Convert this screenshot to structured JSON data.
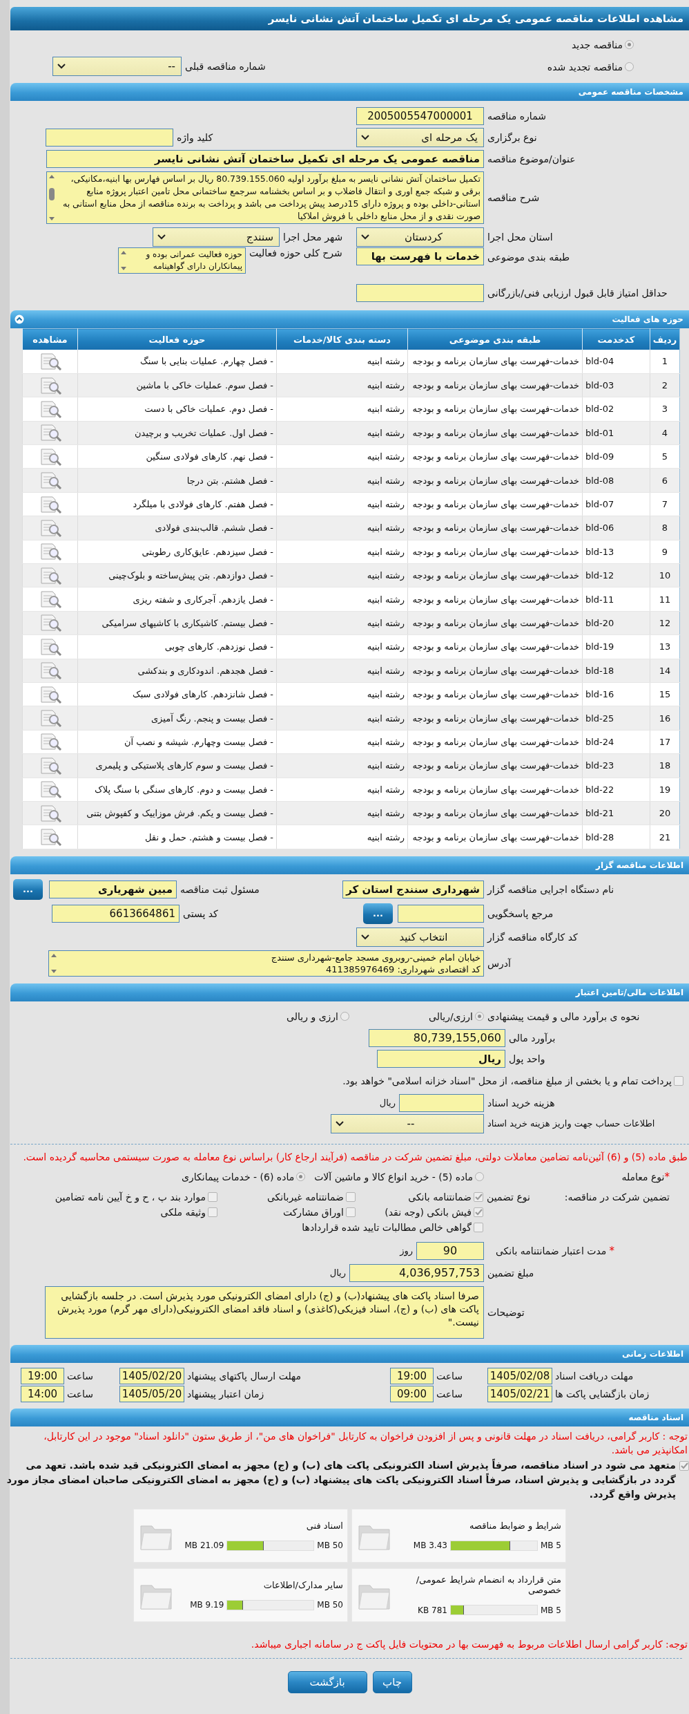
{
  "page_title": "مشاهده اطلاعات مناقصه عمومی یک مرحله ای تکمیل ساختمان آتش نشانی نایسر",
  "tender_status": [
    {
      "label": "مناقصه جدید",
      "selected": true
    },
    {
      "label": "مناقصه تجدید شده",
      "selected": false
    }
  ],
  "previous_tender": {
    "label": "شماره مناقصه قبلی",
    "value": "--"
  },
  "general": {
    "header": "مشخصات مناقصه عمومی",
    "tender_number": {
      "label": "شماره مناقصه",
      "value": "2005005547000001"
    },
    "holding_type": {
      "label": "نوع برگزاری",
      "value": "یک مرحله ای"
    },
    "keyword": {
      "label": "کلید واژه"
    },
    "title": {
      "label": "عنوان/موضوع مناقصه",
      "value": "مناقصه عمومی یک مرحله ای تکمیل ساختمان آتش نشانی نایسر"
    },
    "description": {
      "label": "شرح مناقصه",
      "value": "تکمیل ساختمان آتش نشانی نایسر به مبلغ برآورد اولیه 80.739.155.060 ریال بر اساس فهارس بها ابنیه،مکانیکی، برقی و شبکه جمع اوری و انتقال فاضلاب و بر اساس بخشنامه سرجمع  ساختمانی محل تامین اعتبار پروژه منابع استانی-داخلی بوده و پروژه دارای 15درصد پیش پرداخت می باشد و پرداخت به برنده مناقصه از محل منابع استانی به صورت نقدی و از محل منابع داخلی با فروش املاکیا"
    },
    "province": {
      "label": "استان محل اجرا",
      "value": "کردستان"
    },
    "city": {
      "label": "شهر محل اجرا",
      "value": "سنندج"
    },
    "category": {
      "label": "طبقه بندی موضوعی",
      "value": "خدمات با فهرست بها"
    },
    "activity_summary": {
      "label": "شرح کلی حوزه فعالیت",
      "value": "حوزه فعالیت عمرانی بوده و پیمانکاران دارای گواهینامه"
    },
    "min_score": {
      "label": "حداقل امتیاز قابل قبول ارزیابی فنی/بازرگانی"
    }
  },
  "activities": {
    "header": "حوزه های فعالیت",
    "expanded": true,
    "columns": [
      "ردیف",
      "کدخدمت",
      "طبقه بندی موضوعی",
      "دسته بندی کالا/خدمات",
      "حوزه فعالیت",
      "مشاهده"
    ],
    "rows": [
      {
        "row": "1",
        "code": "bld-04",
        "category": "خدمات-فهرست بهای سازمان برنامه و بودجه",
        "group": "رشته ابنیه",
        "activity": "- فصل چهارم. عملیات بنایی با سنگ"
      },
      {
        "row": "2",
        "code": "bld-03",
        "category": "خدمات-فهرست بهای سازمان برنامه و بودجه",
        "group": "رشته ابنیه",
        "activity": "- فصل سوم. عملیات خاکی با ماشین"
      },
      {
        "row": "3",
        "code": "bld-02",
        "category": "خدمات-فهرست بهای سازمان برنامه و بودجه",
        "group": "رشته ابنیه",
        "activity": "- فصل دوم. عملیات خاکی با دست"
      },
      {
        "row": "4",
        "code": "bld-01",
        "category": "خدمات-فهرست بهای سازمان برنامه و بودجه",
        "group": "رشته ابنیه",
        "activity": "- فصل اول. عملیات تخریب و برچیدن"
      },
      {
        "row": "5",
        "code": "bld-09",
        "category": "خدمات-فهرست بهای سازمان برنامه و بودجه",
        "group": "رشته ابنیه",
        "activity": "- فصل نهم. کارهای فولادی سنگین"
      },
      {
        "row": "6",
        "code": "bld-08",
        "category": "خدمات-فهرست بهای سازمان برنامه و بودجه",
        "group": "رشته ابنیه",
        "activity": "- فصل هشتم. بتن درجا"
      },
      {
        "row": "7",
        "code": "bld-07",
        "category": "خدمات-فهرست بهای سازمان برنامه و بودجه",
        "group": "رشته ابنیه",
        "activity": "- فصل هفتم. کارهای فولادی با میلگرد"
      },
      {
        "row": "8",
        "code": "bld-06",
        "category": "خدمات-فهرست بهای سازمان برنامه و بودجه",
        "group": "رشته ابنیه",
        "activity": "- فصل ششم. قالب‌بندی فولادی"
      },
      {
        "row": "9",
        "code": "bld-13",
        "category": "خدمات-فهرست بهای سازمان برنامه و بودجه",
        "group": "رشته ابنیه",
        "activity": "- فصل سیزدهم. عایق‌کاری رطوبتی"
      },
      {
        "row": "10",
        "code": "bld-12",
        "category": "خدمات-فهرست بهای سازمان برنامه و بودجه",
        "group": "رشته ابنیه",
        "activity": "- فصل دوازدهم. بتن پیش‌ساخته و بلوک‌چینی"
      },
      {
        "row": "11",
        "code": "bld-11",
        "category": "خدمات-فهرست بهای سازمان برنامه و بودجه",
        "group": "رشته ابنیه",
        "activity": "- فصل یازدهم. آجرکاری و شفته ریزی"
      },
      {
        "row": "12",
        "code": "bld-20",
        "category": "خدمات-فهرست بهای سازمان برنامه و بودجه",
        "group": "رشته ابنیه",
        "activity": "- فصل بیستم. کاشیکاری با کاشیهای سرامیکی"
      },
      {
        "row": "13",
        "code": "bld-19",
        "category": "خدمات-فهرست بهای سازمان برنامه و بودجه",
        "group": "رشته ابنیه",
        "activity": "- فصل نوزدهم. کارهای چوبی"
      },
      {
        "row": "14",
        "code": "bld-18",
        "category": "خدمات-فهرست بهای سازمان برنامه و بودجه",
        "group": "رشته ابنیه",
        "activity": "- فصل هجدهم. اندودکاری و بندکشی"
      },
      {
        "row": "15",
        "code": "bld-16",
        "category": "خدمات-فهرست بهای سازمان برنامه و بودجه",
        "group": "رشته ابنیه",
        "activity": "- فصل شانزدهم. کارهای فولادی سبک"
      },
      {
        "row": "16",
        "code": "bld-25",
        "category": "خدمات-فهرست بهای سازمان برنامه و بودجه",
        "group": "رشته ابنیه",
        "activity": "- فصل بیست و پنجم. رنگ آمیزی"
      },
      {
        "row": "17",
        "code": "bld-24",
        "category": "خدمات-فهرست بهای سازمان برنامه و بودجه",
        "group": "رشته ابنیه",
        "activity": "- فصل بیست وچهارم. شیشه و نصب آن"
      },
      {
        "row": "18",
        "code": "bld-23",
        "category": "خدمات-فهرست بهای سازمان برنامه و بودجه",
        "group": "رشته ابنیه",
        "activity": "- فصل بیست و سوم کارهای پلاستیکی و پلیمری"
      },
      {
        "row": "19",
        "code": "bld-22",
        "category": "خدمات-فهرست بهای سازمان برنامه و بودجه",
        "group": "رشته ابنیه",
        "activity": "- فصل بیست و دوم. کارهای سنگی با سنگ پلاک"
      },
      {
        "row": "20",
        "code": "bld-21",
        "category": "خدمات-فهرست بهای سازمان برنامه و بودجه",
        "group": "رشته ابنیه",
        "activity": "- فصل بیست و یکم. فرش موزاییک و کفپوش بتنی"
      },
      {
        "row": "21",
        "code": "bld-28",
        "category": "خدمات-فهرست بهای سازمان برنامه و بودجه",
        "group": "رشته ابنیه",
        "activity": "- فصل بیست و هشتم. حمل و نقل"
      }
    ]
  },
  "organizer": {
    "header": "اطلاعات مناقصه گزار",
    "agency": {
      "label": "نام دستگاه اجرایی مناقصه گزار",
      "value": "شهرداری سنندج استان کر"
    },
    "registrar": {
      "label": "مسئول ثبت مناقصه",
      "value": "مبین شهریاری",
      "button": "..."
    },
    "reference": {
      "label": "مرجع پاسخگویی",
      "button": "..."
    },
    "postal_code": {
      "label": "کد پستی",
      "value": "6613664861"
    },
    "workshop": {
      "label": "کد کارگاه مناقصه گزار",
      "value": "انتخاب کنید"
    },
    "address": {
      "label": "آدرس",
      "lines": [
        "خیابان امام خمینی-روبروی مسجد جامع-شهرداری سنندج",
        "کد اقتصادی شهرداری: 411385976469"
      ]
    }
  },
  "financial": {
    "header": "اطلاعات مالی/تامین اعتبار",
    "pricing": {
      "label": "نحوه ی برآورد مالی و قیمت پیشنهادی",
      "options": [
        {
          "label": "ارزی/ریالی",
          "selected": true
        },
        {
          "label": "ارزی و ریالی",
          "selected": false
        }
      ]
    },
    "estimate": {
      "label": "برآورد مالی",
      "value": "80,739,155,060"
    },
    "currency": {
      "label": "واحد پول",
      "value": "ریال"
    },
    "treasury": {
      "label": "پرداخت تمام و یا بخشی از مبلغ مناقصه، از محل \"اسناد خزانه اسلامی\" خواهد بود.",
      "checked": false
    },
    "doc_fee": {
      "label": "هزینه خرید اسناد",
      "unit": "ریال"
    },
    "account": {
      "label": "اطلاعات حساب جهت واریز هزینه خرید اسناد",
      "value": "--"
    },
    "note": "طبق ماده (5) و (6) آئین‌نامه تضامین معاملات دولتی، مبلغ تضمین شرکت در مناقصه (فرآیند ارجاع کار) براساس نوع معامله به صورت سیستمی محاسبه گردیده است."
  },
  "guarantee": {
    "deal_type": {
      "mark": "*",
      "label": "نوع معامله",
      "options": [
        {
          "label": "ماده (5) - خرید انواع کالا و ماشین آلات",
          "selected": false
        },
        {
          "label": "ماده (6) - خدمات پیمانکاری",
          "selected": true
        }
      ]
    },
    "label": "تضمین شرکت در مناقصه:",
    "type_label": "نوع تضمین",
    "types": [
      {
        "label": "ضمانتنامه بانکی",
        "checked": true
      },
      {
        "label": "ضمانتنامه غیربانکی",
        "checked": false
      },
      {
        "label": "موارد بند پ ، ح و خ آیین نامه تضامین",
        "checked": false
      },
      {
        "label": "فیش بانکی (وجه نقد)",
        "checked": true
      },
      {
        "label": "اوراق مشارکت",
        "checked": false
      },
      {
        "label": "وثیقه ملکی",
        "checked": false
      },
      {
        "label": "گواهی خالص مطالبات تایید شده قراردادها",
        "checked": false
      }
    ],
    "validity": {
      "mark": "*",
      "label": "مدت اعتبار ضمانتنامه بانکی",
      "value": "90",
      "unit": "روز"
    },
    "amount": {
      "label": "مبلغ تضمین",
      "value": "4,036,957,753",
      "unit": "ریال"
    },
    "notes": {
      "label": "توضیحات",
      "value": "صرفا اسناد پاکت های پیشنهاد(ب) و (ج) دارای امضای الکترونیکی مورد پذیرش است. در جلسه بازگشایی پاکت های (ب) و (ج)، اسناد فیزیکی(کاغذی) و اسناد فاقد امضای الکترونیکی(دارای مهر گرم) مورد پذیرش نیست.\""
    }
  },
  "schedule": {
    "header": "اطلاعات زمانی",
    "rows": [
      [
        {
          "label": "مهلت دریافت اسناد",
          "date": "1405/02/08",
          "time_label": "ساعت",
          "time": "19:00"
        },
        {
          "label": "مهلت ارسال پاکتهای پیشنهاد",
          "date": "1405/02/20",
          "time_label": "ساعت",
          "time": "19:00"
        }
      ],
      [
        {
          "label": "زمان بازگشایی پاکت ها",
          "date": "1405/02/21",
          "time_label": "ساعت",
          "time": "09:00"
        },
        {
          "label": "زمان اعتبار پیشنهاد",
          "date": "1405/05/20",
          "time_label": "ساعت",
          "time": "14:00"
        }
      ]
    ]
  },
  "documents": {
    "header": "اسناد مناقصه",
    "notice": "توجه : کاربر گرامی، دریافت اسناد در مهلت قانونی و پس از افزودن فراخوان به کارتابل \"فراخوان های من\"، از طریق ستون \"دانلود اسناد\" موجود در این کارتابل، امکانپذیر می باشد.",
    "commitment": {
      "checked": true,
      "text": "متعهد می شود در اسناد مناقصه، صرفاً پذیرش اسناد الکترونیکی پاکت های (ب) و (ج) مجهز به امضای الکترونیکی قید شده باشد. تعهد می گردد در بازگشایی و پذیرش اسناد، صرفاً اسناد الکترونیکی پاکت های پیشنهاد (ب) و (ج) مجهز به امضای الکترونیکی صاحبان امضای مجاز مورد پذیرش واقع گردد."
    },
    "files": [
      {
        "title": "شرایط و ضوابط مناقصه",
        "used": "3.43 MB",
        "max": "5 MB",
        "level": 0.686
      },
      {
        "title": "اسناد فنی",
        "used": "21.09 MB",
        "max": "50 MB",
        "level": 0.422
      },
      {
        "title": "متن قرارداد به انضمام شرایط عمومی/خصوصی",
        "used": "781 KB",
        "max": "5 MB",
        "level": 0.156
      },
      {
        "title": "سایر مدارک/اطلاعات",
        "used": "9.19 MB",
        "max": "50 MB",
        "level": 0.184
      }
    ],
    "footer_notice": "توجه: کاربر گرامی ارسال اطلاعات مربوط به فهرست بها در محتویات فایل پاکت ج در سامانه اجباری میباشد."
  },
  "buttons": [
    "چاپ",
    "بازگشت"
  ]
}
